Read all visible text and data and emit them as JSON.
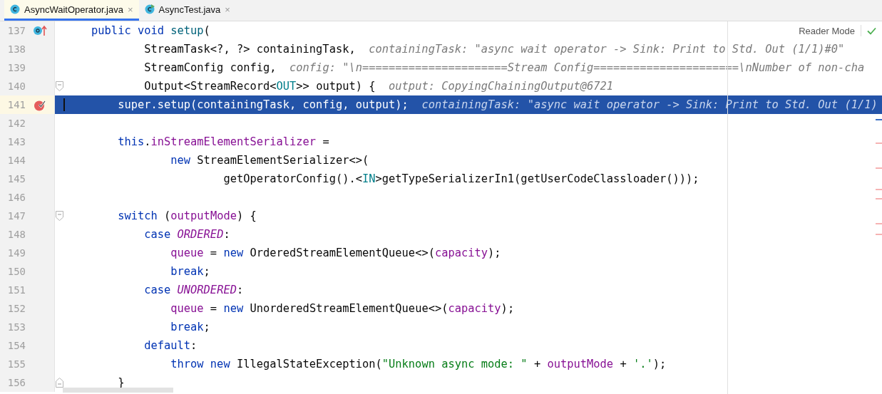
{
  "tabs": [
    {
      "label": "AsyncWaitOperator.java",
      "selected": true,
      "kind": "class",
      "close": "×"
    },
    {
      "label": "AsyncTest.java",
      "selected": false,
      "kind": "test-class",
      "close": "×"
    }
  ],
  "reader_mode": "Reader Mode",
  "lines": [
    {
      "number": "137",
      "selected": false,
      "marker": {
        "kind": "override"
      },
      "tokens": [
        {
          "kind": "keyword",
          "text": "    public void "
        },
        {
          "kind": "declaration",
          "text": "setup"
        },
        {
          "kind": "plain",
          "text": "("
        }
      ]
    },
    {
      "number": "138",
      "selected": false,
      "tokens": [
        {
          "kind": "plain",
          "text": "            StreamTask<?, ?> containingTask,"
        }
      ],
      "hint": "containingTask: \"async wait operator -> Sink: Print to Std. Out (1/1)#0\""
    },
    {
      "number": "139",
      "selected": false,
      "tokens": [
        {
          "kind": "plain",
          "text": "            StreamConfig config,"
        }
      ],
      "hint": "config: \"\\n======================Stream Config======================\\nNumber of non-cha"
    },
    {
      "number": "140",
      "selected": false,
      "fold": {
        "kind": "start"
      },
      "tokens": [
        {
          "kind": "plain",
          "text": "            Output<StreamRecord<"
        },
        {
          "kind": "type-param",
          "text": "OUT"
        },
        {
          "kind": "plain",
          "text": ">> output) {"
        }
      ],
      "hint": "output: CopyingChainingOutput@6721"
    },
    {
      "number": "141",
      "selected": true,
      "marker": {
        "kind": "breakpoint"
      },
      "tokens": [
        {
          "kind": "plain",
          "text": "        super.setup(containingTask, config, output);"
        }
      ],
      "hint": "containingTask: \"async wait operator -> Sink: Print to Std. Out (1/1)"
    },
    {
      "number": "142",
      "selected": false
    },
    {
      "number": "143",
      "selected": false,
      "tokens": [
        {
          "kind": "keyword",
          "text": "        this"
        },
        {
          "kind": "plain",
          "text": "."
        },
        {
          "kind": "field",
          "text": "inStreamElementSerializer"
        },
        {
          "kind": "plain",
          "text": " ="
        }
      ]
    },
    {
      "number": "144",
      "selected": false,
      "tokens": [
        {
          "kind": "keyword",
          "text": "                new "
        },
        {
          "kind": "plain",
          "text": "StreamElementSerializer<>("
        }
      ]
    },
    {
      "number": "145",
      "selected": false,
      "tokens": [
        {
          "kind": "plain",
          "text": "                        getOperatorConfig().<"
        },
        {
          "kind": "type-param",
          "text": "IN"
        },
        {
          "kind": "plain",
          "text": ">getTypeSerializerIn1(getUserCodeClassloader()));"
        }
      ]
    },
    {
      "number": "146",
      "selected": false
    },
    {
      "number": "147",
      "selected": false,
      "fold": {
        "kind": "start"
      },
      "tokens": [
        {
          "kind": "keyword",
          "text": "        switch "
        },
        {
          "kind": "plain",
          "text": "("
        },
        {
          "kind": "field",
          "text": "outputMode"
        },
        {
          "kind": "plain",
          "text": ") {"
        }
      ]
    },
    {
      "number": "148",
      "selected": false,
      "tokens": [
        {
          "kind": "keyword",
          "text": "            case "
        },
        {
          "kind": "constant",
          "text": "ORDERED"
        },
        {
          "kind": "plain",
          "text": ":"
        }
      ]
    },
    {
      "number": "149",
      "selected": false,
      "tokens": [
        {
          "kind": "field",
          "text": "                queue"
        },
        {
          "kind": "plain",
          "text": " = "
        },
        {
          "kind": "keyword",
          "text": "new "
        },
        {
          "kind": "plain",
          "text": "OrderedStreamElementQueue<>("
        },
        {
          "kind": "field",
          "text": "capacity"
        },
        {
          "kind": "plain",
          "text": ");"
        }
      ]
    },
    {
      "number": "150",
      "selected": false,
      "tokens": [
        {
          "kind": "keyword",
          "text": "                break"
        },
        {
          "kind": "plain",
          "text": ";"
        }
      ]
    },
    {
      "number": "151",
      "selected": false,
      "tokens": [
        {
          "kind": "keyword",
          "text": "            case "
        },
        {
          "kind": "constant",
          "text": "UNORDERED"
        },
        {
          "kind": "plain",
          "text": ":"
        }
      ]
    },
    {
      "number": "152",
      "selected": false,
      "tokens": [
        {
          "kind": "field",
          "text": "                queue"
        },
        {
          "kind": "plain",
          "text": " = "
        },
        {
          "kind": "keyword",
          "text": "new "
        },
        {
          "kind": "plain",
          "text": "UnorderedStreamElementQueue<>("
        },
        {
          "kind": "field",
          "text": "capacity"
        },
        {
          "kind": "plain",
          "text": ");"
        }
      ]
    },
    {
      "number": "153",
      "selected": false,
      "tokens": [
        {
          "kind": "keyword",
          "text": "                break"
        },
        {
          "kind": "plain",
          "text": ";"
        }
      ]
    },
    {
      "number": "154",
      "selected": false,
      "tokens": [
        {
          "kind": "keyword",
          "text": "            default"
        },
        {
          "kind": "plain",
          "text": ":"
        }
      ]
    },
    {
      "number": "155",
      "selected": false,
      "tokens": [
        {
          "kind": "keyword",
          "text": "                throw new "
        },
        {
          "kind": "plain",
          "text": "IllegalStateException("
        },
        {
          "kind": "string",
          "text": "\"Unknown async mode: \""
        },
        {
          "kind": "plain",
          "text": " + "
        },
        {
          "kind": "field",
          "text": "outputMode"
        },
        {
          "kind": "plain",
          "text": " + "
        },
        {
          "kind": "string",
          "text": "'.'"
        },
        {
          "kind": "plain",
          "text": ");"
        }
      ]
    },
    {
      "number": "156",
      "selected": false,
      "fold": {
        "kind": "end"
      },
      "tokens": [
        {
          "kind": "plain",
          "text": "        }"
        }
      ]
    }
  ]
}
